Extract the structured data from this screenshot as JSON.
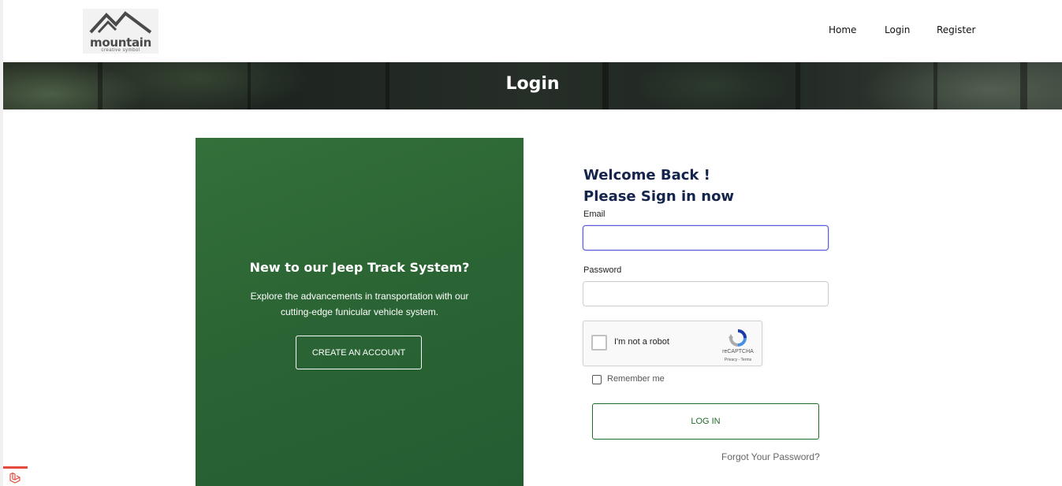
{
  "header": {
    "logo": {
      "word": "mountain",
      "tagline": "creative symbol"
    },
    "nav": [
      {
        "label": "Home"
      },
      {
        "label": "Login"
      },
      {
        "label": "Register"
      }
    ]
  },
  "banner": {
    "title": "Login"
  },
  "promo": {
    "title": "New to our Jeep Track System?",
    "text": "Explore the advancements in transportation with our cutting-edge funicular vehicle system.",
    "button_label": "CREATE AN ACCOUNT"
  },
  "form": {
    "welcome_line1": "Welcome Back !",
    "welcome_line2": "Please Sign in now",
    "email_label": "Email",
    "email_value": "",
    "password_label": "Password",
    "password_value": "",
    "captcha": {
      "label": "I'm not a robot",
      "brand": "reCAPTCHA",
      "terms": "Privacy - Terms"
    },
    "remember_label": "Remember me",
    "login_label": "LOG IN",
    "forgot_label": "Forgot Your Password?"
  },
  "colors": {
    "promo_green": "#2b6534",
    "heading_navy": "#14244a",
    "login_green": "#1f6b2a",
    "focus_border": "#5b5fd6"
  }
}
